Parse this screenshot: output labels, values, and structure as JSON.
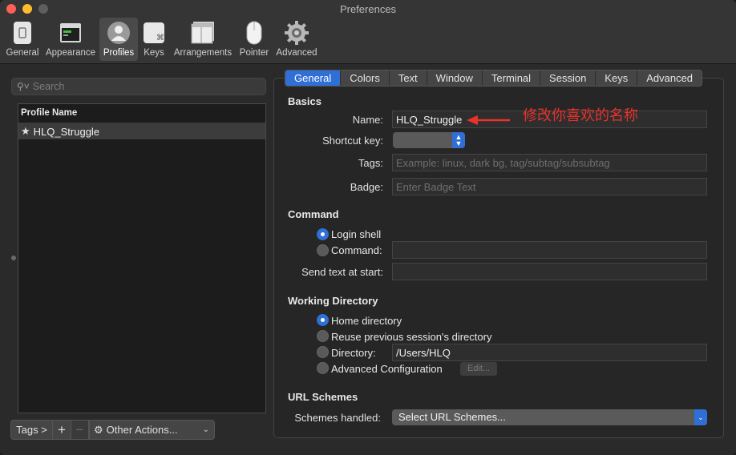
{
  "window": {
    "title": "Preferences"
  },
  "toolbar": {
    "items": [
      {
        "label": "General",
        "icon": "general-icon"
      },
      {
        "label": "Appearance",
        "icon": "appearance-icon"
      },
      {
        "label": "Profiles",
        "icon": "profiles-icon",
        "active": true
      },
      {
        "label": "Keys",
        "icon": "keys-icon"
      },
      {
        "label": "Arrangements",
        "icon": "arrangements-icon"
      },
      {
        "label": "Pointer",
        "icon": "pointer-icon"
      },
      {
        "label": "Advanced",
        "icon": "advanced-gear-icon"
      }
    ]
  },
  "sidebar": {
    "search_placeholder": "Search",
    "column_header": "Profile Name",
    "profiles": [
      {
        "name": "HLQ_Struggle",
        "default": true
      }
    ],
    "tags_button": "Tags >",
    "add_button": "+",
    "remove_button": "−",
    "other_actions": "Other Actions..."
  },
  "tabs": [
    "General",
    "Colors",
    "Text",
    "Window",
    "Terminal",
    "Session",
    "Keys",
    "Advanced"
  ],
  "active_tab": "General",
  "basics": {
    "heading": "Basics",
    "name_label": "Name:",
    "name_value": "HLQ_Struggle",
    "shortcut_label": "Shortcut key:",
    "tags_label": "Tags:",
    "tags_placeholder": "Example: linux, dark bg, tag/subtag/subsubtag",
    "badge_label": "Badge:",
    "badge_placeholder": "Enter Badge Text"
  },
  "command": {
    "heading": "Command",
    "login_shell": "Login shell",
    "command_option": "Command:",
    "send_text_label": "Send text at start:"
  },
  "working_directory": {
    "heading": "Working Directory",
    "home": "Home directory",
    "reuse": "Reuse previous session's directory",
    "directory_label": "Directory:",
    "directory_value": "/Users/HLQ",
    "advanced": "Advanced Configuration",
    "edit_button": "Edit..."
  },
  "url_schemes": {
    "heading": "URL Schemes",
    "label": "Schemes handled:",
    "select_value": "Select URL Schemes..."
  },
  "annotation": {
    "text": "修改你喜欢的名称",
    "color": "#e8322b"
  },
  "colors": {
    "accent": "#2f6fd6",
    "background": "#2a2a2a"
  }
}
